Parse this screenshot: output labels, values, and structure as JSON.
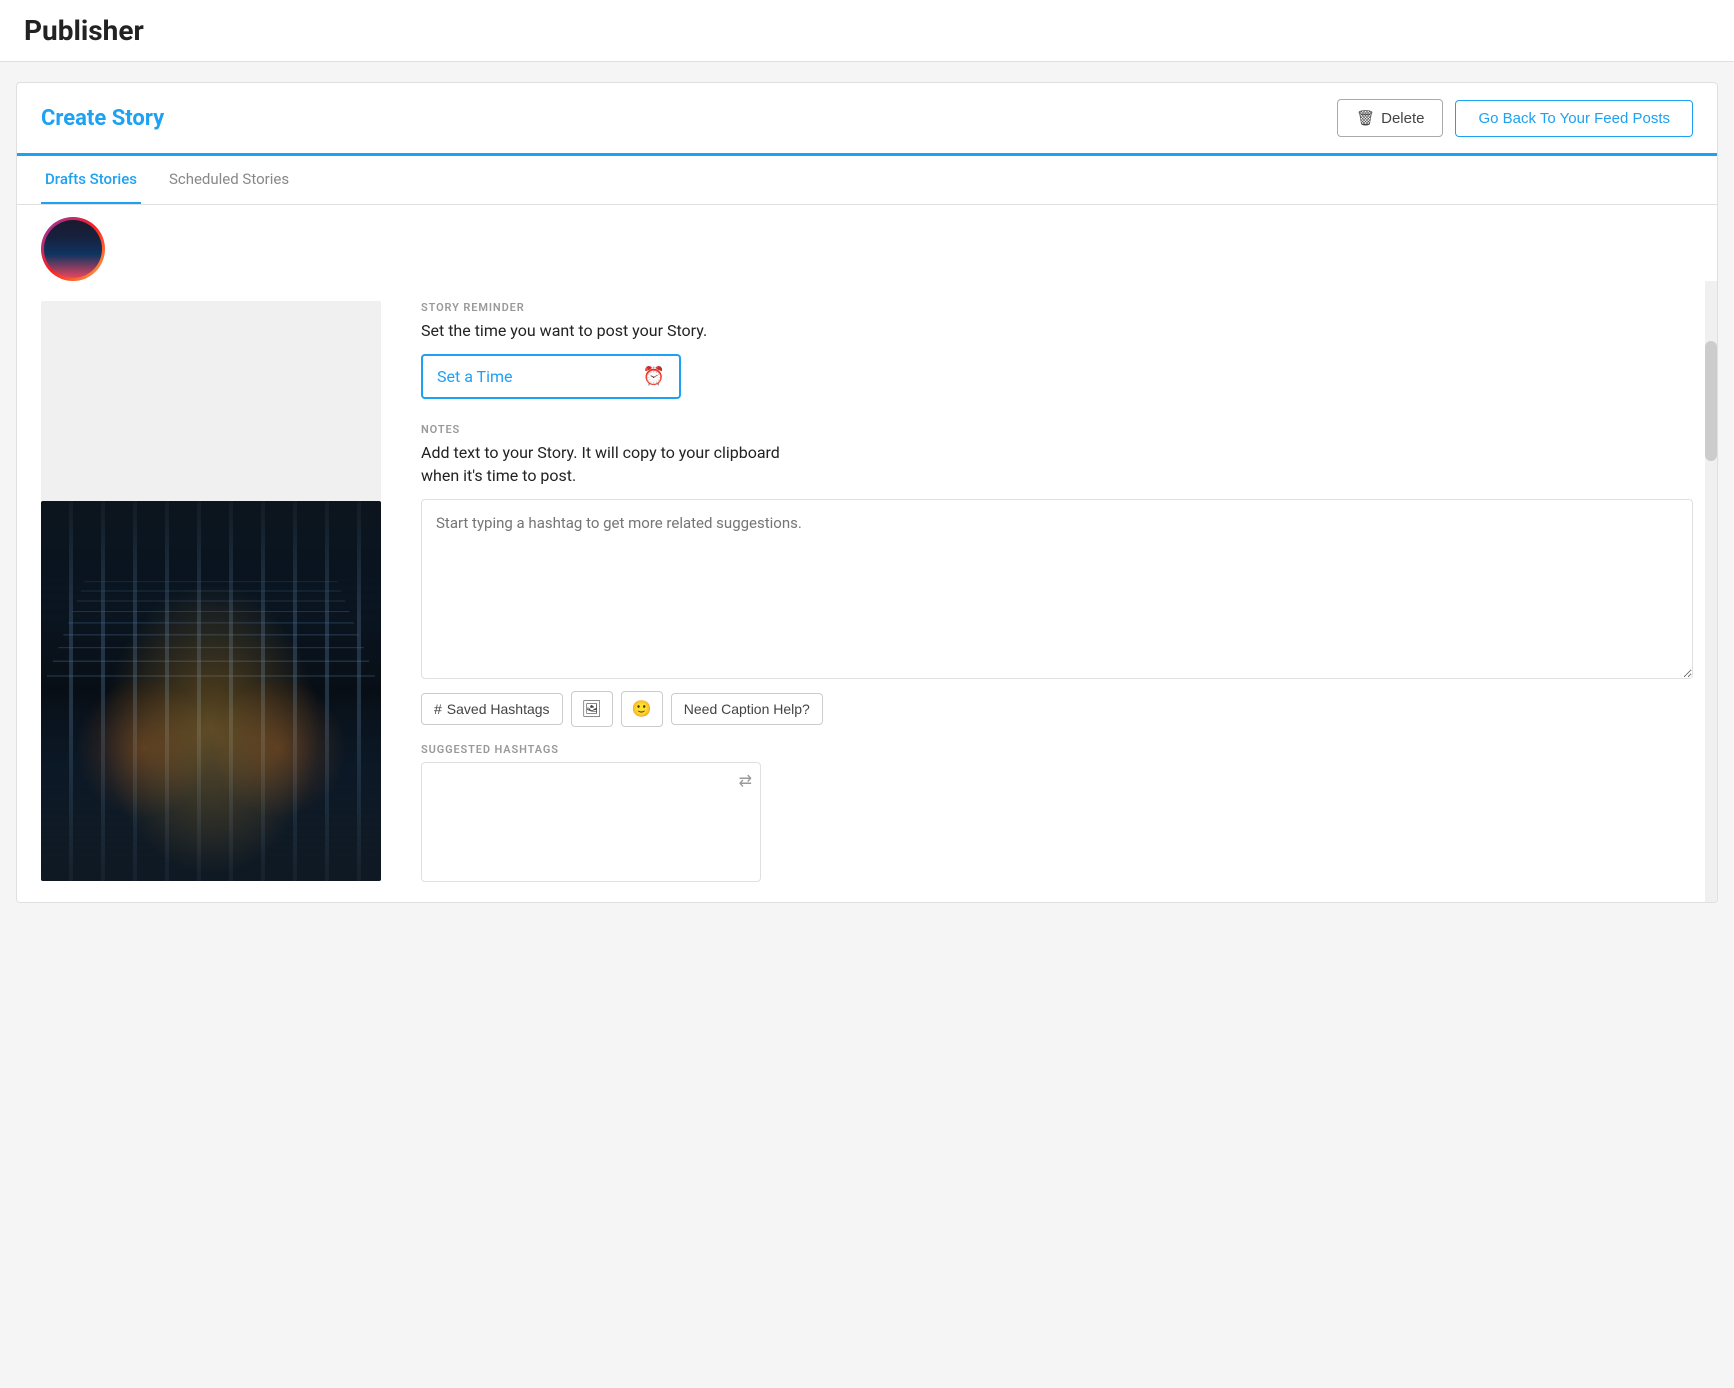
{
  "app": {
    "title": "Publisher"
  },
  "card": {
    "title": "Create Story",
    "delete_label": "Delete",
    "back_label": "Go Back To Your Feed Posts"
  },
  "tabs": [
    {
      "id": "drafts",
      "label": "Drafts Stories",
      "active": true
    },
    {
      "id": "scheduled",
      "label": "Scheduled Stories",
      "active": false
    }
  ],
  "story_reminder": {
    "section_label": "STORY REMINDER",
    "description": "Set the time you want to post your Story.",
    "time_placeholder": "Set a Time"
  },
  "notes": {
    "section_label": "NOTES",
    "description": "Add text to your Story. It will copy to your clipboard\nwhen it's time to post.",
    "textarea_placeholder": "Start typing a hashtag to get more related suggestions."
  },
  "toolbar": {
    "saved_hashtags_label": "Saved Hashtags",
    "caption_help_label": "Need Caption Help?"
  },
  "suggested_hashtags": {
    "section_label": "SUGGESTED HASHTAGS"
  },
  "colors": {
    "accent": "#1da1f2",
    "border": "#e0e0e0",
    "muted": "#999999"
  }
}
